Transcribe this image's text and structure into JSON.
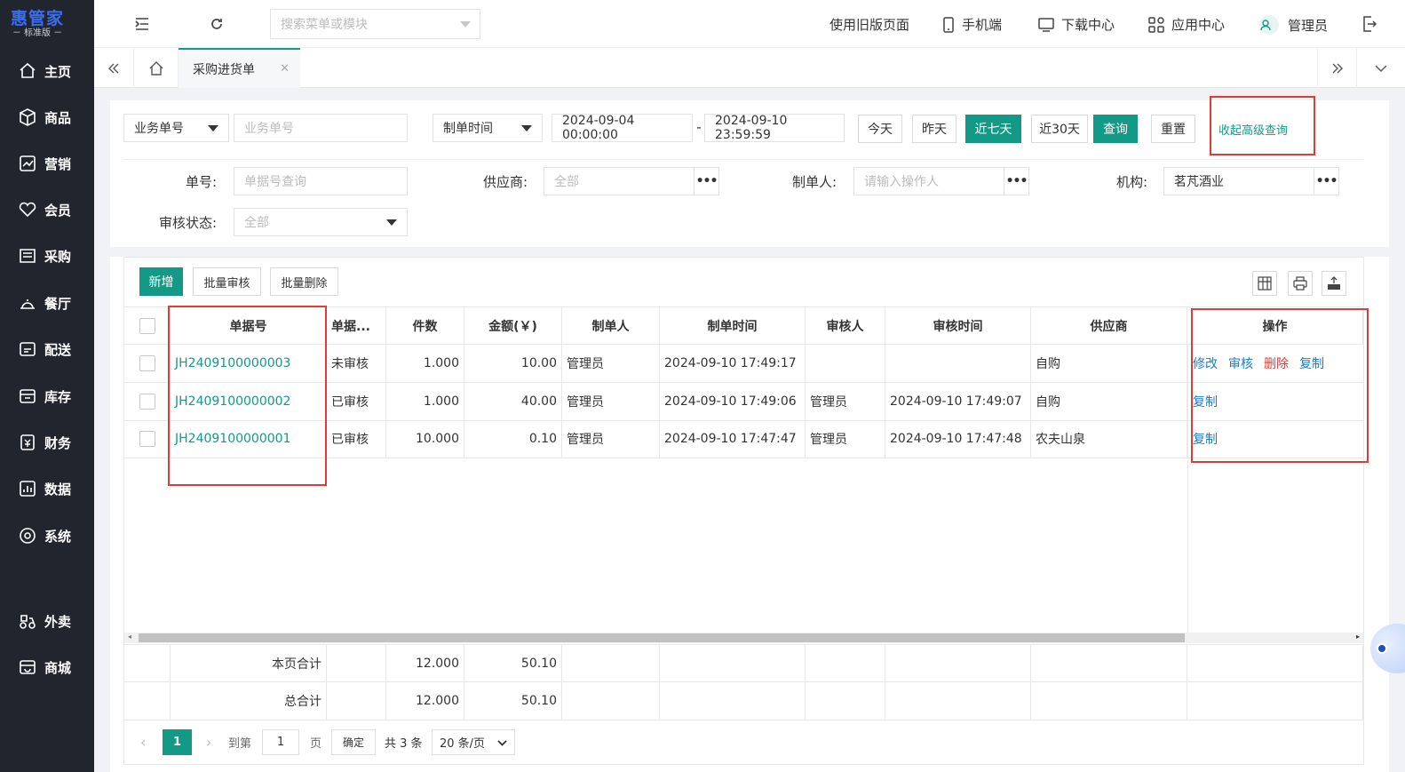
{
  "logo": {
    "main": "惠管家",
    "sub": "－ 标准版 －"
  },
  "sidebar": {
    "items": [
      {
        "label": "主页",
        "icon": "home-icon"
      },
      {
        "label": "商品",
        "icon": "box-icon"
      },
      {
        "label": "营销",
        "icon": "chart-icon"
      },
      {
        "label": "会员",
        "icon": "heart-icon"
      },
      {
        "label": "采购",
        "icon": "purchase-icon"
      },
      {
        "label": "餐厅",
        "icon": "restaurant-icon"
      },
      {
        "label": "配送",
        "icon": "delivery-icon"
      },
      {
        "label": "库存",
        "icon": "inventory-icon"
      },
      {
        "label": "财务",
        "icon": "finance-icon"
      },
      {
        "label": "数据",
        "icon": "data-icon"
      },
      {
        "label": "系统",
        "icon": "system-icon"
      },
      {
        "label": "外卖",
        "icon": "takeout-icon"
      },
      {
        "label": "商城",
        "icon": "mall-icon"
      }
    ]
  },
  "topbar": {
    "search_placeholder": "搜索菜单或模块",
    "old_page": "使用旧版页面",
    "mobile": "手机端",
    "download": "下载中心",
    "apps": "应用中心",
    "user": "管理员"
  },
  "tabs": {
    "active": "采购进货单"
  },
  "filters": {
    "biz_select": "业务单号",
    "biz_placeholder": "业务单号",
    "time_select": "制单时间",
    "start_time": "2024-09-04 00:00:00",
    "sep": "-",
    "end_time": "2024-09-10 23:59:59",
    "btn_today": "今天",
    "btn_yesterday": "昨天",
    "btn_7days": "近七天",
    "btn_30days": "近30天",
    "btn_query": "查询",
    "btn_reset": "重置",
    "advanced_toggle": "收起高级查询",
    "label_no": "单号:",
    "no_placeholder": "单据号查询",
    "label_supplier": "供应商:",
    "supplier_value": "全部",
    "label_creator": "制单人:",
    "creator_placeholder": "请输入操作人",
    "label_org": "机构:",
    "org_value": "茗芃酒业",
    "label_audit": "审核状态:",
    "audit_value": "全部"
  },
  "toolbar": {
    "add": "新增",
    "batch_audit": "批量审核",
    "batch_delete": "批量删除"
  },
  "table": {
    "headers": [
      "单据号",
      "单据...",
      "件数",
      "金额(￥)",
      "制单人",
      "制单时间",
      "审核人",
      "审核时间",
      "供应商",
      "操作"
    ],
    "rows": [
      {
        "no": "JH2409100000003",
        "status": "未审核",
        "qty": "1.000",
        "amount": "10.00",
        "creator": "管理员",
        "created": "2024-09-10 17:49:17",
        "auditor": "",
        "audited": "",
        "supplier": "自购",
        "actions": [
          "修改",
          "审核",
          "删除",
          "复制"
        ]
      },
      {
        "no": "JH2409100000002",
        "status": "已审核",
        "qty": "1.000",
        "amount": "40.00",
        "creator": "管理员",
        "created": "2024-09-10 17:49:06",
        "auditor": "管理员",
        "audited": "2024-09-10 17:49:07",
        "supplier": "自购",
        "actions": [
          "复制"
        ]
      },
      {
        "no": "JH2409100000001",
        "status": "已审核",
        "qty": "10.000",
        "amount": "0.10",
        "creator": "管理员",
        "created": "2024-09-10 17:47:47",
        "auditor": "管理员",
        "audited": "2024-09-10 17:47:48",
        "supplier": "农夫山泉",
        "actions": [
          "复制"
        ]
      }
    ],
    "page_total": {
      "label": "本页合计",
      "qty": "12.000",
      "amount": "50.10"
    },
    "grand_total": {
      "label": "总合计",
      "qty": "12.000",
      "amount": "50.10"
    }
  },
  "pager": {
    "current": "1",
    "goto": "到第",
    "page_input": "1",
    "page_unit": "页",
    "confirm": "确定",
    "total": "共 3 条",
    "size": "20 条/页"
  },
  "colors": {
    "accent": "#129a87",
    "sidebar": "#20252e",
    "link": "#1a7dd6",
    "danger": "#e53935"
  }
}
